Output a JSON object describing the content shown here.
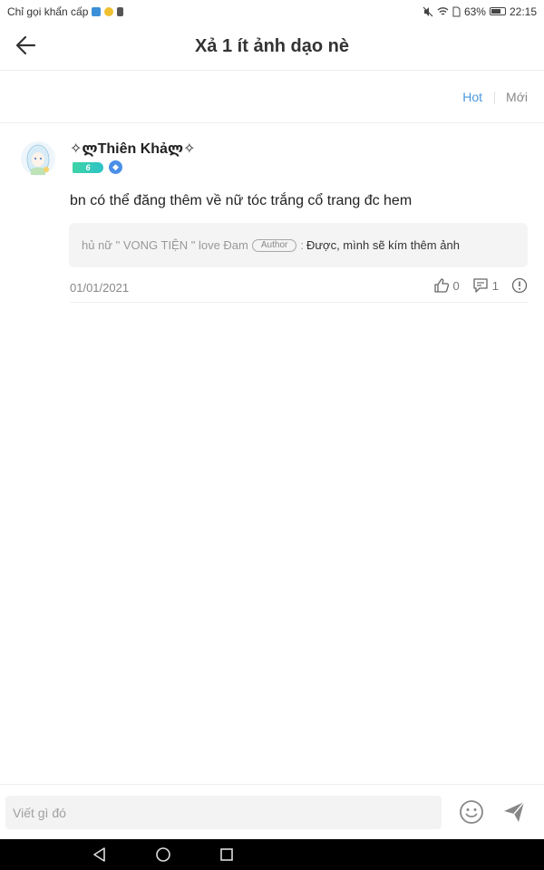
{
  "status_bar": {
    "carrier": "Chỉ gọi khẩn cấp",
    "battery": "63%",
    "time": "22:15"
  },
  "header": {
    "title": "Xả 1 ít ảnh dạo nè"
  },
  "sort": {
    "hot": "Hot",
    "new": "Mới",
    "active": "Hot"
  },
  "comment": {
    "username": "✧ლThiên Khảლ✧",
    "level": "6",
    "text": "bn có thể đăng thêm về nữ tóc trắng cổ trang đc hem",
    "reply": {
      "author": "hủ nữ \" VONG TIỆN \" love Đam",
      "tag": "Author",
      "colon": ":",
      "text": "Được, mình sẽ kím thêm ảnh"
    },
    "date": "01/01/2021",
    "likes": "0",
    "replies": "1"
  },
  "input": {
    "placeholder": "Viết gì đó"
  },
  "colors": {
    "accent": "#4a98e0",
    "level_badge": "#3fd3a6"
  }
}
